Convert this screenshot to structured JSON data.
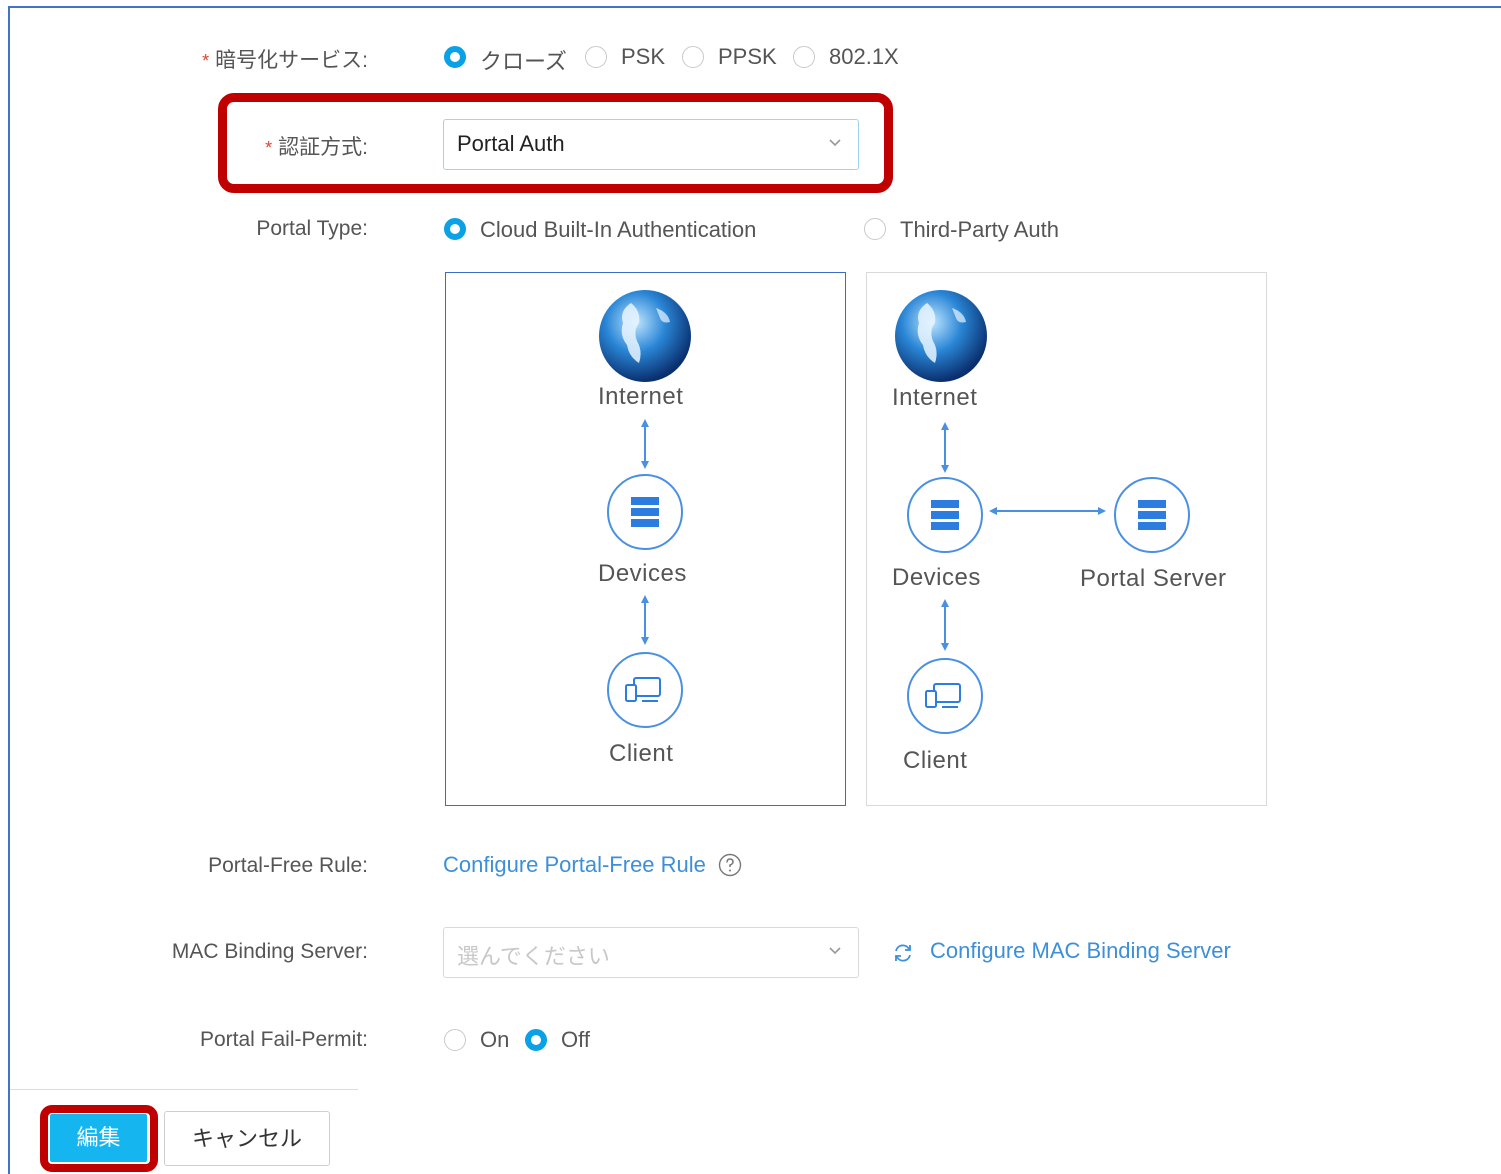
{
  "encryption": {
    "label": "暗号化サービス:",
    "options": [
      "クローズ",
      "PSK",
      "PPSK",
      "802.1X"
    ],
    "selected": "クローズ"
  },
  "auth_method": {
    "label": "認証方式:",
    "value": "Portal Auth"
  },
  "portal_type": {
    "label": "Portal Type:",
    "options": [
      "Cloud Built-In Authentication",
      "Third-Party Auth"
    ],
    "selected": "Cloud Built-In Authentication"
  },
  "diagram_builtin": {
    "internet": "Internet",
    "devices": "Devices",
    "client": "Client"
  },
  "diagram_thirdparty": {
    "internet": "Internet",
    "devices": "Devices",
    "portal_server": "Portal Server",
    "client": "Client"
  },
  "portal_free_rule": {
    "label": "Portal-Free Rule:",
    "link": "Configure Portal-Free Rule"
  },
  "mac_binding": {
    "label": "MAC Binding Server:",
    "placeholder": "選んでください",
    "link": "Configure MAC Binding Server"
  },
  "fail_permit": {
    "label": "Portal Fail-Permit:",
    "options": [
      "On",
      "Off"
    ],
    "selected": "Off"
  },
  "buttons": {
    "edit": "編集",
    "cancel": "キャンセル"
  },
  "colors": {
    "accent": "#0aa1e6",
    "link": "#3d8fd9",
    "highlight": "#c00000",
    "edit_button": "#15b5f0"
  }
}
